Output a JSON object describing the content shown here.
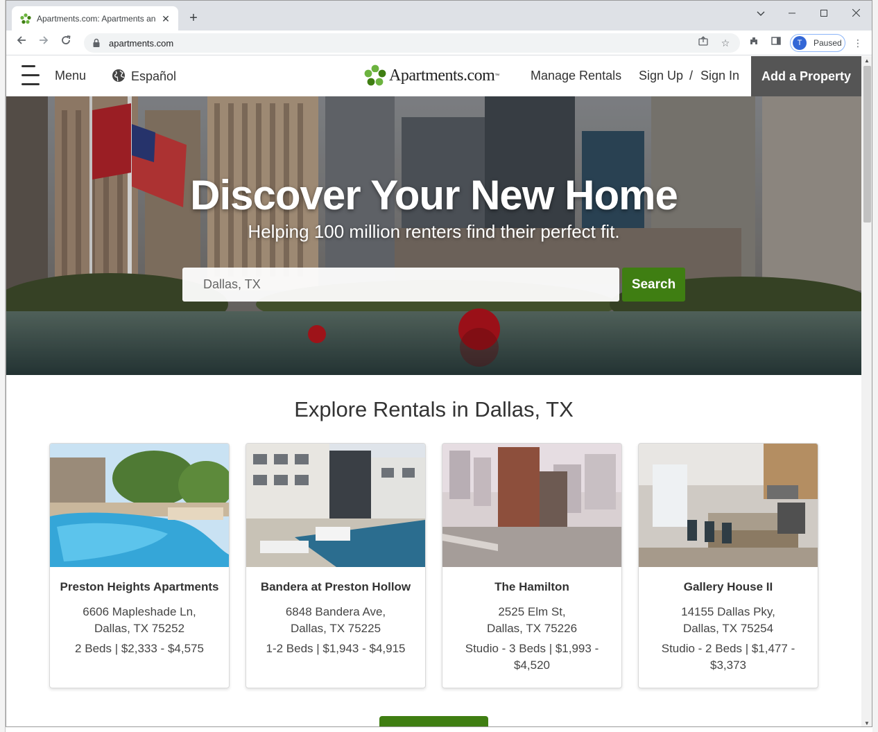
{
  "browser": {
    "tab_title": "Apartments.com: Apartments and Houses for Rent",
    "url": "apartments.com",
    "profile_initial": "T",
    "profile_status": "Paused",
    "icons": [
      "back-icon",
      "forward-icon",
      "reload-icon",
      "lock-icon",
      "share-icon",
      "star-icon",
      "extensions-icon",
      "sidebar-icon",
      "more-icon"
    ]
  },
  "header": {
    "menu_label": "Menu",
    "language_label": "Español",
    "logo_text": "Apartments.com",
    "logo_tm": "™",
    "manage_rentals": "Manage Rentals",
    "sign_up": "Sign Up",
    "divider": "/",
    "sign_in": "Sign In",
    "add_property": "Add a Property"
  },
  "hero": {
    "title": "Discover Your New Home",
    "subtitle": "Helping 100 million renters find their perfect fit.",
    "search_value": "Dallas, TX",
    "search_button": "Search"
  },
  "explore": {
    "title": "Explore Rentals in Dallas, TX",
    "cards": [
      {
        "name": "Preston Heights Apartments",
        "street": "6606 Mapleshade Ln,",
        "city": "Dallas, TX 75252",
        "price": "2 Beds | $2,333 - $4,575"
      },
      {
        "name": "Bandera at Preston Hollow",
        "street": "6848 Bandera Ave,",
        "city": "Dallas, TX 75225",
        "price": "1-2 Beds | $1,943 - $4,915"
      },
      {
        "name": "The Hamilton",
        "street": "2525 Elm St,",
        "city": "Dallas, TX 75226",
        "price": "Studio - 3 Beds | $1,993 - $4,520"
      },
      {
        "name": "Gallery House II",
        "street": "14155 Dallas Pky,",
        "city": "Dallas, TX 75254",
        "price": "Studio - 2 Beds | $1,477 - $3,373"
      }
    ]
  },
  "colors": {
    "brand_green": "#3f7e12",
    "add_property_bg": "#555555",
    "text": "#333333"
  }
}
